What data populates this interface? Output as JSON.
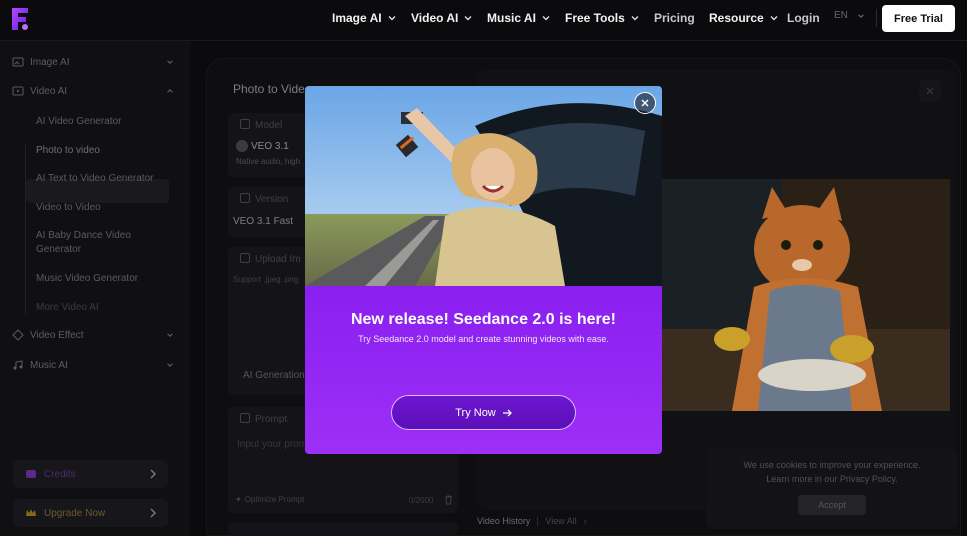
{
  "header": {
    "nav": [
      {
        "label": "Image AI",
        "dropdown": true
      },
      {
        "label": "Video AI",
        "dropdown": true
      },
      {
        "label": "Music AI",
        "dropdown": true
      },
      {
        "label": "Free Tools",
        "dropdown": true
      },
      {
        "label": "Pricing",
        "dropdown": false
      },
      {
        "label": "Resource",
        "dropdown": true
      }
    ],
    "login": "Login",
    "lang": "EN",
    "free_trial": "Free Trial",
    "accent": "#8a1ff0"
  },
  "sidebar": {
    "sections": [
      {
        "label": "Image AI",
        "icon": "image-icon"
      },
      {
        "label": "Video AI",
        "icon": "video-icon"
      },
      {
        "label": "Video Effect",
        "icon": "sparkle-icon"
      },
      {
        "label": "Music AI",
        "icon": "music-icon"
      }
    ],
    "video_items": [
      "AI Video Generator",
      "Photo to video",
      "AI Text to Video Generator",
      "Video to Video",
      "AI Baby Dance Video Generator",
      "Music Video Generator",
      "More Video AI"
    ],
    "credits": "Credits",
    "upgrade": "Upgrade Now"
  },
  "main": {
    "title": "Photo to Video",
    "model_label": "Model",
    "model_value": "VEO 3.1",
    "model_sub": "Native audio, high",
    "version_label": "Version",
    "version_value": "VEO 3.1 Fast",
    "upload_label": "Upload Im",
    "upload_hint": "Support .jpeg .png",
    "ai_generation": "AI Generation",
    "prompt_label": "Prompt",
    "prompt_placeholder": "Input your prom",
    "optimize": "Optimize Prompt",
    "counter": "0/2000"
  },
  "history": {
    "label": "Video History",
    "view_all": "View All"
  },
  "cookie": {
    "line1": "We use cookies to improve your experience.",
    "line2": "Learn more in our Privacy Policy.",
    "accept": "Accept"
  },
  "modal": {
    "title": "New release! Seedance 2.0 is here!",
    "subtitle": "Try Seedance 2.0 model and create stunning videos with ease.",
    "cta": "Try Now"
  }
}
